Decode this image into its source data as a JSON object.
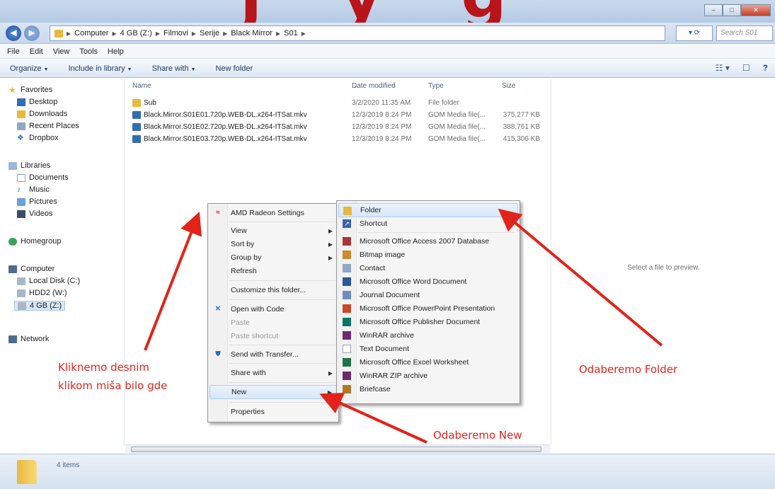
{
  "title_fragment": "j y g",
  "window_controls": [
    "–",
    "□",
    "✕"
  ],
  "address": {
    "crumbs": [
      "Computer",
      "4 GB (Z:)",
      "Filmovi",
      "Serije",
      "Black Mirror",
      "S01"
    ],
    "refresh_label": "▾ ⟳",
    "search_placeholder": "Search S01"
  },
  "menubar": [
    "File",
    "Edit",
    "View",
    "Tools",
    "Help"
  ],
  "toolbar": {
    "items": [
      "Organize",
      "Include in library",
      "Share with",
      "New folder"
    ],
    "right_icons": [
      "☷ ▾",
      "☐",
      "?"
    ]
  },
  "nav": {
    "favorites": "Favorites",
    "favorites_items": [
      "Desktop",
      "Downloads",
      "Recent Places",
      "Dropbox"
    ],
    "libraries": "Libraries",
    "libraries_items": [
      "Documents",
      "Music",
      "Pictures",
      "Videos"
    ],
    "homegroup": "Homegroup",
    "computer": "Computer",
    "computer_items": [
      "Local Disk (C:)",
      "HDD2 (W:)",
      "4 GB (Z:)"
    ],
    "network": "Network"
  },
  "columns": {
    "name": "Name",
    "date": "Date modified",
    "type": "Type",
    "size": "Size"
  },
  "files": [
    {
      "name": "Sub",
      "date": "3/2/2020 11:35 AM",
      "type": "File folder",
      "size": ""
    },
    {
      "name": "Black.Mirror.S01E01.720p.WEB-DL.x264-ITSat.mkv",
      "date": "12/3/2019 8:24 PM",
      "type": "GOM Media file(...",
      "size": "375,277 KB"
    },
    {
      "name": "Black.Mirror.S01E02.720p.WEB-DL.x264-ITSat.mkv",
      "date": "12/3/2019 8:24 PM",
      "type": "GOM Media file(...",
      "size": "388,761 KB"
    },
    {
      "name": "Black.Mirror.S01E03.720p.WEB-DL.x264-ITSat.mkv",
      "date": "12/3/2019 8:24 PM",
      "type": "GOM Media file(...",
      "size": "415,306 KB"
    }
  ],
  "preview_text": "Select a file to preview.",
  "status_text": "4 items",
  "context_menu": {
    "amd": "AMD Radeon Settings",
    "view": "View",
    "sort_by": "Sort by",
    "group_by": "Group by",
    "refresh": "Refresh",
    "customize": "Customize this folder...",
    "open_with_code": "Open with Code",
    "paste": "Paste",
    "paste_shortcut": "Paste shortcut",
    "send_with_transfer": "Send with Transfer...",
    "share_with": "Share with",
    "new": "New",
    "properties": "Properties"
  },
  "new_submenu": {
    "folder": "Folder",
    "shortcut": "Shortcut",
    "items": [
      "Microsoft Office Access 2007 Database",
      "Bitmap image",
      "Contact",
      "Microsoft Office Word Document",
      "Journal Document",
      "Microsoft Office PowerPoint Presentation",
      "Microsoft Office Publisher Document",
      "WinRAR archive",
      "Text Document",
      "Microsoft Office Excel Worksheet",
      "WinRAR ZIP archive",
      "Briefcase"
    ]
  },
  "annotations": {
    "right_click_line1": "Kliknemo desnim",
    "right_click_line2": "klikom miša bilo gde",
    "choose_folder": "Odaberemo Folder",
    "choose_new": "Odaberemo New"
  },
  "colors": {
    "annotation_red": "#e2231a",
    "folder_yellow": "#e9b93c",
    "mkv_blue": "#2f6db5"
  }
}
